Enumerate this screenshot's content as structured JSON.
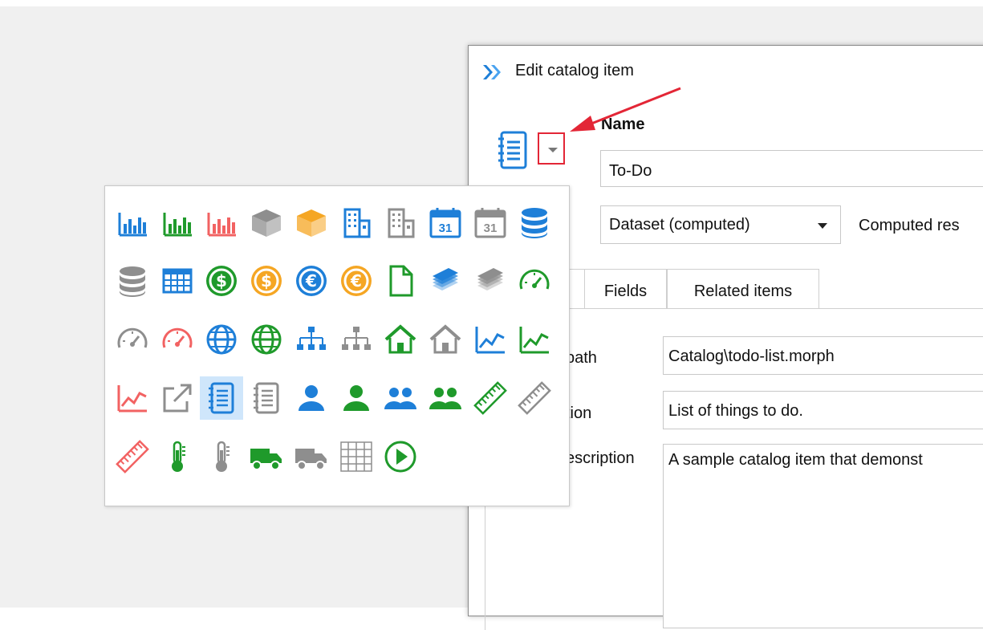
{
  "dialog": {
    "title": "Edit catalog item",
    "name_label": "Name",
    "name_value": "To-Do",
    "type_value": "Dataset (computed)",
    "computed_label": "Computed res",
    "tabs": [
      {
        "label": ""
      },
      {
        "label": "Fields"
      },
      {
        "label": "Related items"
      }
    ],
    "fields": [
      {
        "label": "path",
        "value": "Catalog\\todo-list.morph"
      },
      {
        "label": "tion",
        "value": "List of things to do."
      },
      {
        "label": "escription",
        "value": "A sample catalog item that demonst"
      }
    ]
  },
  "icon_popup": {
    "selected": "notebook-blue-icon",
    "icons": [
      [
        "bar-chart-blue-icon",
        "bar-chart-green-icon",
        "bar-chart-red-icon",
        "box-gray-icon",
        "box-orange-icon",
        "building-blue-icon",
        "building-gray-icon",
        "calendar-blue-icon",
        "calendar-gray-icon",
        "database-blue-icon"
      ],
      [
        "database-gray-icon",
        "table-blue-icon",
        "dollar-green-icon",
        "dollar-orange-icon",
        "euro-blue-icon",
        "euro-orange-icon",
        "document-green-icon",
        "money-stack-blue-icon",
        "money-stack-gray-icon",
        "gauge-green-icon"
      ],
      [
        "gauge-gray-icon",
        "gauge-red-icon",
        "globe-blue-icon",
        "globe-green-icon",
        "hierarchy-blue-icon",
        "hierarchy-gray-icon",
        "home-green-icon",
        "home-gray-icon",
        "line-chart-blue-icon",
        "line-chart-green-icon"
      ],
      [
        "line-chart-red-icon",
        "external-link-gray-icon",
        "notebook-blue-icon",
        "notebook-gray-icon",
        "person-blue-icon",
        "person-green-icon",
        "people-blue-icon",
        "people-green-icon",
        "ruler-green-icon",
        "ruler-gray-icon"
      ],
      [
        "ruler-red-icon",
        "thermometer-green-icon",
        "thermometer-gray-icon",
        "truck-green-icon",
        "truck-gray-icon",
        "grid-gray-icon",
        "play-green-icon"
      ]
    ],
    "calendar_day": "31"
  },
  "colors": {
    "blue": "#1e7fd8",
    "green": "#1f9a2b",
    "red": "#f26262",
    "gray": "#8e8e8e",
    "orange": "#f5a623",
    "highlight_border": "#e32636",
    "arrow": "#e32636"
  }
}
